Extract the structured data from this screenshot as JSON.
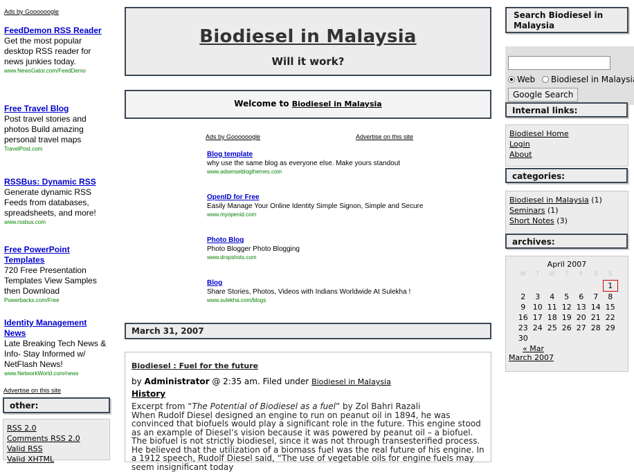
{
  "left_ads": {
    "ads_by": "Ads by Goooooogle",
    "items": [
      {
        "title": "FeedDemon RSS Reader",
        "text": "Get the most popular desktop RSS reader for news junkies today.",
        "url": "www.NewsGator.com/FeedDemo"
      },
      {
        "title": "Free Travel Blog",
        "text": "Post travel stories and photos Build amazing personal travel maps",
        "url": "TravelPost.com"
      },
      {
        "title": "RSSBus: Dynamic RSS",
        "text": "Generate dynamic RSS Feeds from databases, spreadsheets, and more!",
        "url": "www.rssbus.com"
      },
      {
        "title": "Free PowerPoint Templates",
        "text": "720 Free Presentation Templates View Samples then Download",
        "url": "Powerbacks.com/Free"
      },
      {
        "title": "Identity Management News",
        "text": "Late Breaking Tech News & Info- Stay Informed w/ NetFlash News!",
        "url": "www.NetworkWorld.com/news"
      }
    ],
    "advertise": "Advertise on this site"
  },
  "other": {
    "heading": "other:",
    "links": [
      "RSS 2.0",
      "Comments RSS 2.0",
      "Valid RSS",
      "Valid XHTML"
    ]
  },
  "header": {
    "title": "Biodiesel in Malaysia",
    "tagline": "Will it work?"
  },
  "welcome": {
    "prefix": "Welcome to",
    "link": "Biodiesel in Malaysia"
  },
  "center_ads": {
    "ads_by": "Ads by Goooooogle",
    "advertise": "Advertise on this site",
    "items": [
      {
        "title": "Blog template",
        "text": "why use the same blog as everyone else. Make yours standout",
        "url": "www.adsenseblogthemes.com"
      },
      {
        "title": "OpenID for Free",
        "text": "Easily Manage Your Online Identity Simple Signon, Simple and Secure",
        "url": "www.myopenid.com"
      },
      {
        "title": "Photo Blog",
        "text": "Photo Blogger Photo Blogging",
        "url": "www.dropshots.com"
      },
      {
        "title": "Blog",
        "text": "Share Stories, Photos, Videos with Indians Worldwide At Sulekha !",
        "url": "www.sulekha.com/blogs"
      }
    ]
  },
  "post": {
    "date": "March 31, 2007",
    "title": "Biodiesel : Fuel for the future",
    "by": "by",
    "author": "Administrator",
    "meta": "@ 2:35 am. Filed under",
    "category": "Biodiesel in Malaysia",
    "heading": "History",
    "excerpt_prefix": "Excerpt from “",
    "excerpt_work": "The Potential of Biodiesel as a fuel",
    "excerpt_suffix": "” by Zol Bahri Razali",
    "body": "When Rudolf Diesel designed an engine to run on peanut oil in 1894, he was convinced that biofuels would play a significant role in the future. This engine stood as an example of Diesel’s vision because it was powered by peanut oil – a biofuel. The biofuel is not strictly biodiesel, since it was not through transesterified process. He believed that the utilization of a biomass fuel was the real future of his engine. In a 1912 speech, Rudolf Diesel said, “The use of vegetable oils for engine fuels may seem insignificant today"
  },
  "search": {
    "heading": "Search Biodiesel in Malaysia",
    "input_value": "",
    "option_web": "Web",
    "option_site": "Biodiesel in Malaysia",
    "button": "Google Search"
  },
  "internal_links": {
    "heading": "Internal links:",
    "links": [
      "Biodiesel Home",
      "Login",
      "About"
    ]
  },
  "categories": {
    "heading": "categories:",
    "items": [
      {
        "name": "Biodiesel in Malaysia",
        "count": "(1)"
      },
      {
        "name": "Seminars",
        "count": "(1)"
      },
      {
        "name": "Short Notes",
        "count": "(3)"
      }
    ]
  },
  "archives": {
    "heading": "archives:",
    "calendar_title": "April 2007",
    "weekdays": [
      "M",
      "T",
      "W",
      "T",
      "F",
      "S",
      "S"
    ],
    "weeks": [
      [
        "",
        "",
        "",
        "",
        "",
        "",
        "1"
      ],
      [
        "2",
        "3",
        "4",
        "5",
        "6",
        "7",
        "8"
      ],
      [
        "9",
        "10",
        "11",
        "12",
        "13",
        "14",
        "15"
      ],
      [
        "16",
        "17",
        "18",
        "19",
        "20",
        "21",
        "22"
      ],
      [
        "23",
        "24",
        "25",
        "26",
        "27",
        "28",
        "29"
      ],
      [
        "30",
        "",
        "",
        "",
        "",
        "",
        ""
      ]
    ],
    "today": "1",
    "prev_link": "« Mar",
    "month_link": "March 2007"
  }
}
